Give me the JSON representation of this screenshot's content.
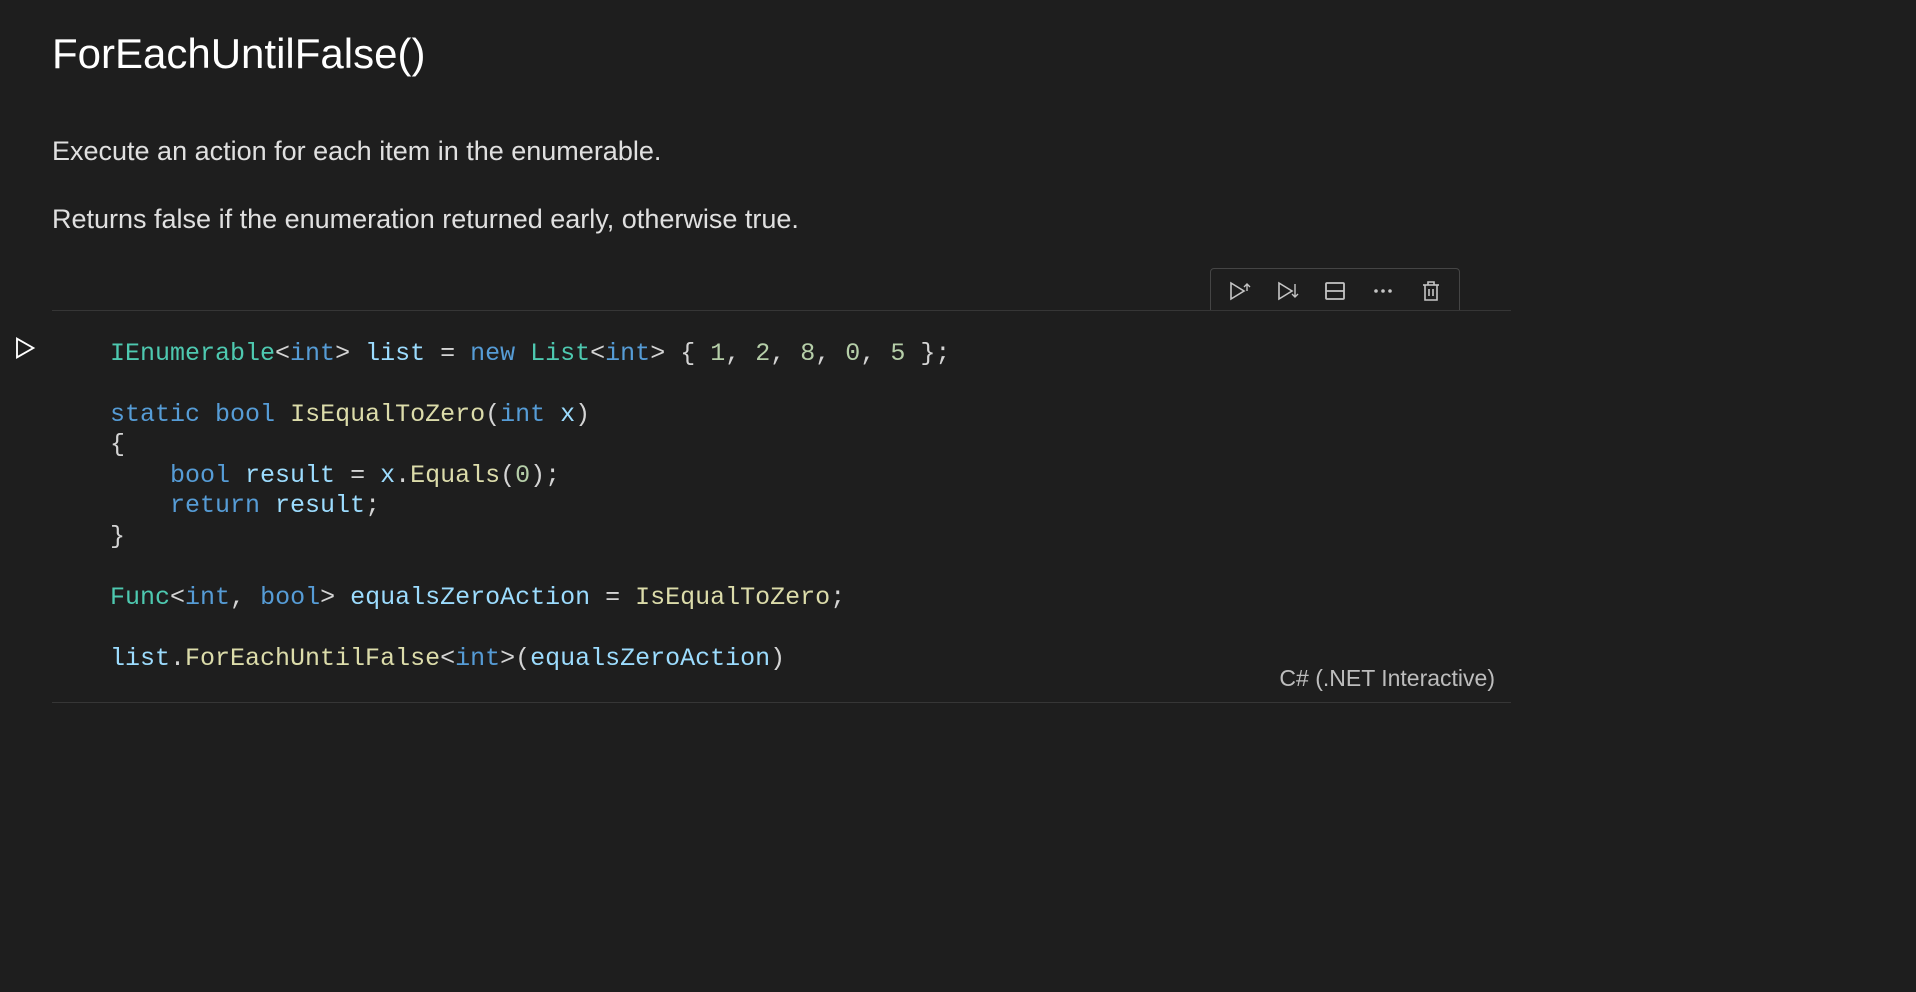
{
  "markdown": {
    "heading": "ForEachUntilFalse()",
    "p1": "Execute an action for each item in the enumerable.",
    "p2": "Returns false if the enumeration returned early, otherwise true."
  },
  "toolbar": {
    "run_above": "run-cells-above",
    "run_below": "run-cell-and-below",
    "split": "split-cell",
    "more": "more-actions",
    "delete": "delete-cell"
  },
  "gutter": {
    "run": "run-cell"
  },
  "code": {
    "l1_t1": "IEnumerable",
    "l1_t2": "<",
    "l1_t3": "int",
    "l1_t4": "> ",
    "l1_t5": "list",
    "l1_t6": " = ",
    "l1_t7": "new",
    "l1_t8": " ",
    "l1_t9": "List",
    "l1_t10": "<",
    "l1_t11": "int",
    "l1_t12": "> { ",
    "l1_t13": "1",
    "l1_t14": ", ",
    "l1_t15": "2",
    "l1_t16": ", ",
    "l1_t17": "8",
    "l1_t18": ", ",
    "l1_t19": "0",
    "l1_t20": ", ",
    "l1_t21": "5",
    "l1_t22": " };",
    "blank": "",
    "l3_t1": "static",
    "l3_t2": " ",
    "l3_t3": "bool",
    "l3_t4": " ",
    "l3_t5": "IsEqualToZero",
    "l3_t6": "(",
    "l3_t7": "int",
    "l3_t8": " ",
    "l3_t9": "x",
    "l3_t10": ")",
    "l4": "{",
    "l5_t1": "    ",
    "l5_t2": "bool",
    "l5_t3": " ",
    "l5_t4": "result",
    "l5_t5": " = ",
    "l5_t6": "x",
    "l5_t7": ".",
    "l5_t8": "Equals",
    "l5_t9": "(",
    "l5_t10": "0",
    "l5_t11": ");",
    "l6_t1": "    ",
    "l6_t2": "return",
    "l6_t3": " ",
    "l6_t4": "result",
    "l6_t5": ";",
    "l7": "}",
    "l9_t1": "Func",
    "l9_t2": "<",
    "l9_t3": "int",
    "l9_t4": ", ",
    "l9_t5": "bool",
    "l9_t6": "> ",
    "l9_t7": "equalsZeroAction",
    "l9_t8": " = ",
    "l9_t9": "IsEqualToZero",
    "l9_t10": ";",
    "l11_t1": "list",
    "l11_t2": ".",
    "l11_t3": "ForEachUntilFalse",
    "l11_t4": "<",
    "l11_t5": "int",
    "l11_t6": ">(",
    "l11_t7": "equalsZeroAction",
    "l11_t8": ")"
  },
  "kernel": {
    "label": "C# (.NET Interactive)"
  }
}
